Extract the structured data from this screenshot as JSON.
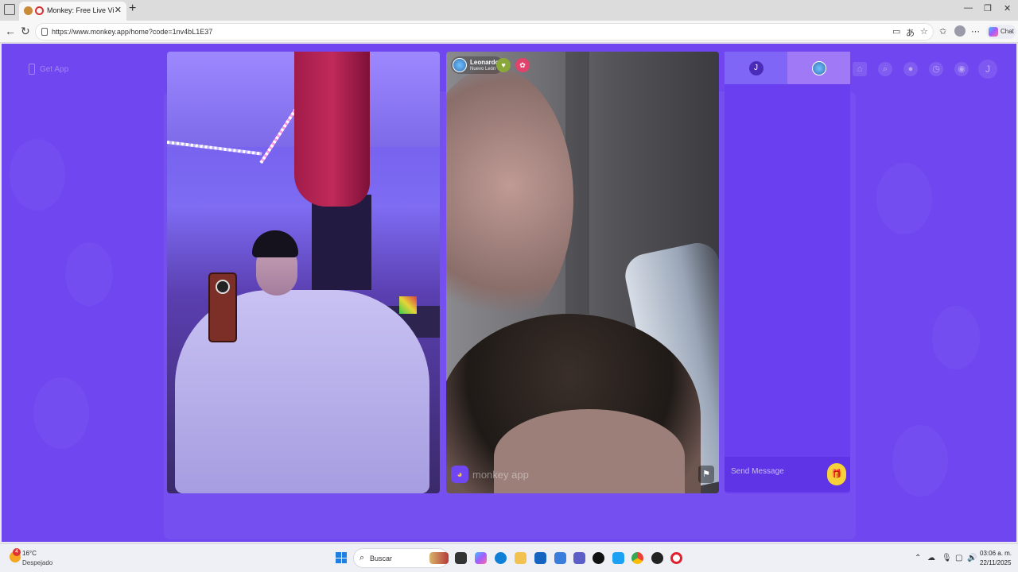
{
  "browser": {
    "tab_title": "Monkey: Free Live Video Ch...",
    "url": "https://www.monkey.app/home?code=1nv4bL1E37",
    "copilot_label": "Chat"
  },
  "page": {
    "get_app_label": "Get App",
    "user_initial": "J"
  },
  "video_right": {
    "username": "Leonardo",
    "location": "Nuevo León",
    "watermark": "monkey app"
  },
  "chat": {
    "me_initial": "J",
    "placeholder": "Send Message"
  },
  "taskbar": {
    "weather_temp": "16°C",
    "weather_desc": "Despejado",
    "weather_badge": "4",
    "search_label": "Buscar",
    "time": "03:06 a. m.",
    "date": "22/11/2025"
  }
}
